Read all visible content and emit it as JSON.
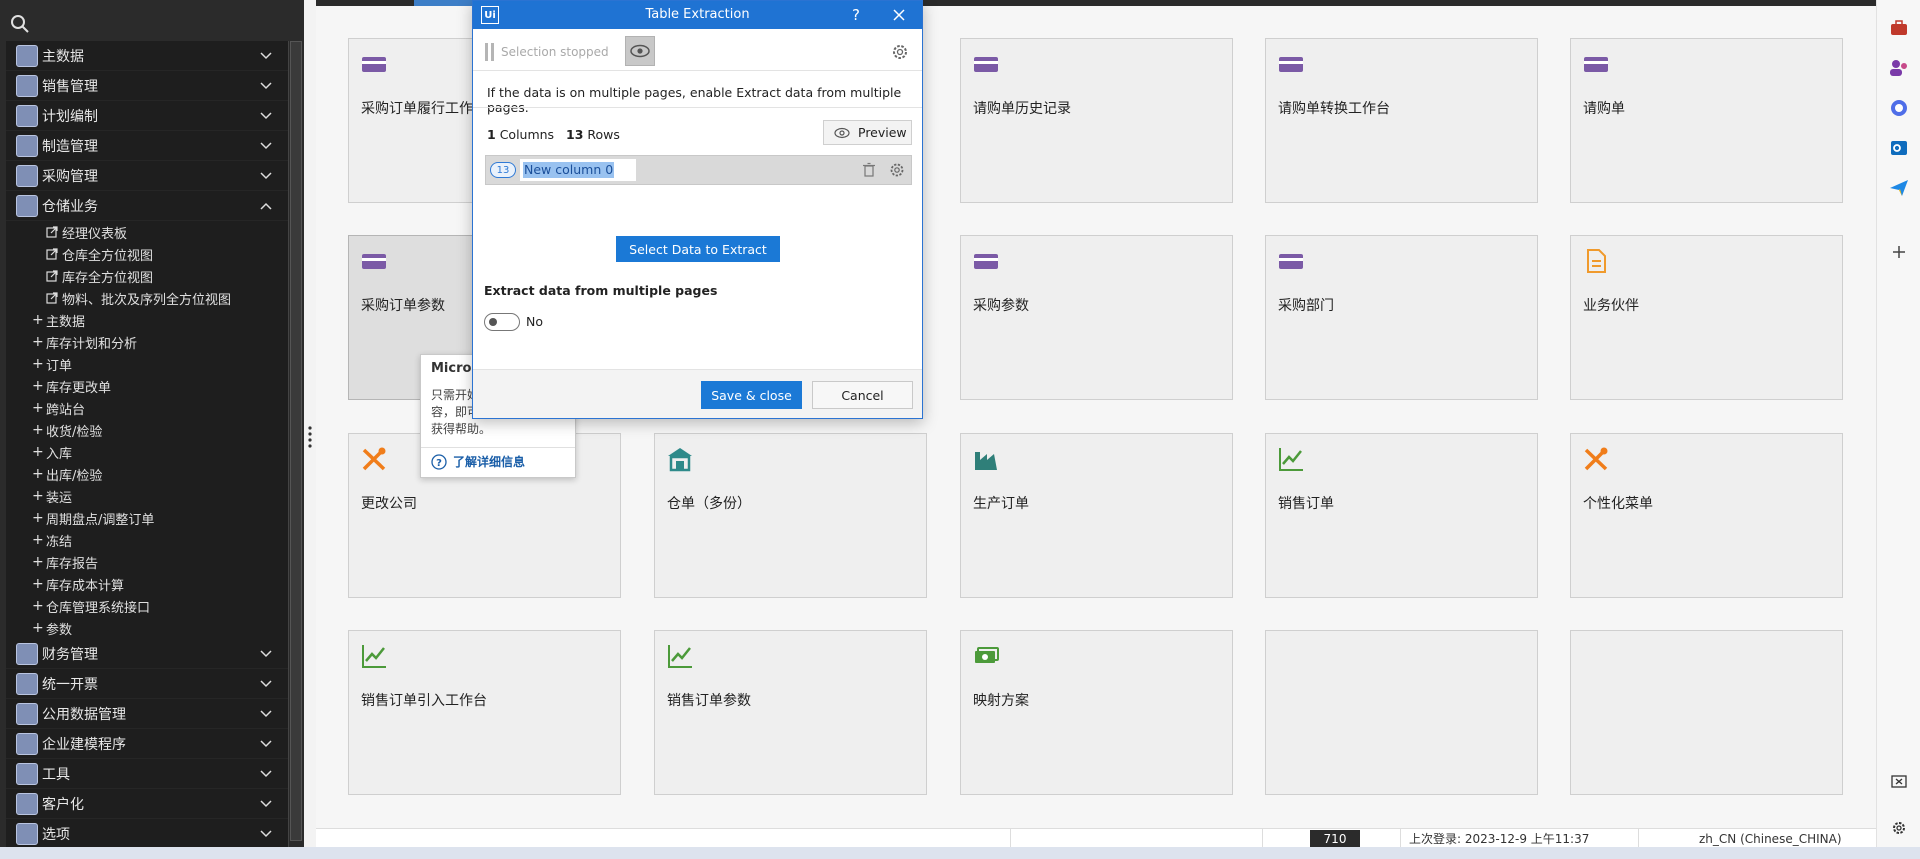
{
  "sidebar": {
    "modules_top": [
      {
        "label": "主数据"
      },
      {
        "label": "销售管理"
      },
      {
        "label": "计划编制"
      },
      {
        "label": "制造管理"
      },
      {
        "label": "采购管理"
      }
    ],
    "expanded_module": {
      "label": "仓储业务"
    },
    "links": [
      {
        "label": "经理仪表板"
      },
      {
        "label": "仓库全方位视图"
      },
      {
        "label": "库存全方位视图"
      },
      {
        "label": "物料、批次及序列全方位视图"
      }
    ],
    "groups": [
      {
        "label": "主数据"
      },
      {
        "label": "库存计划和分析"
      },
      {
        "label": "订单"
      },
      {
        "label": "库存更改单"
      },
      {
        "label": "跨站台"
      },
      {
        "label": "收货/检验"
      },
      {
        "label": "入库"
      },
      {
        "label": "出库/检验"
      },
      {
        "label": "装运"
      },
      {
        "label": "周期盘点/调整订单"
      },
      {
        "label": "冻结"
      },
      {
        "label": "库存报告"
      },
      {
        "label": "库存成本计算"
      },
      {
        "label": "仓库管理系统接口"
      },
      {
        "label": "参数"
      }
    ],
    "modules_bottom": [
      {
        "label": "财务管理"
      },
      {
        "label": "统一开票"
      },
      {
        "label": "公用数据管理"
      },
      {
        "label": "企业建模程序"
      },
      {
        "label": "工具"
      },
      {
        "label": "客户化"
      },
      {
        "label": "选项"
      }
    ]
  },
  "tiles": [
    {
      "label": "采购订单履行工作",
      "icon": "card-icon",
      "color": "#7b5aa6"
    },
    {
      "label": "请购单历史记录",
      "icon": "card-icon",
      "color": "#7b5aa6"
    },
    {
      "label": "请购单转换工作台",
      "icon": "card-icon",
      "color": "#7b5aa6"
    },
    {
      "label": "请购单",
      "icon": "card-icon",
      "color": "#7b5aa6"
    },
    {
      "label": "采购订单参数",
      "icon": "card-icon",
      "color": "#7b5aa6"
    },
    {
      "label": "采购参数",
      "icon": "card-icon",
      "color": "#7b5aa6"
    },
    {
      "label": "采购部门",
      "icon": "card-icon",
      "color": "#7b5aa6"
    },
    {
      "label": "业务伙伴",
      "icon": "document-icon",
      "color": "#f09a2c"
    },
    {
      "label": "更改公司",
      "icon": "tools-icon",
      "color": "#f07d1a"
    },
    {
      "label": "仓单（多份）",
      "icon": "warehouse-icon",
      "color": "#2e8a8a"
    },
    {
      "label": "生产订单",
      "icon": "factory-icon",
      "color": "#2f7f79"
    },
    {
      "label": "销售订单",
      "icon": "line-chart-icon",
      "color": "#4c9a3a"
    },
    {
      "label": "个性化菜单",
      "icon": "tools-icon",
      "color": "#f07d1a"
    },
    {
      "label": "销售订单引入工作台",
      "icon": "line-chart-icon",
      "color": "#4c9a3a"
    },
    {
      "label": "销售订单参数",
      "icon": "line-chart-icon",
      "color": "#4c9a3a"
    },
    {
      "label": "映射方案",
      "icon": "cash-icon",
      "color": "#4c9a3a"
    },
    {
      "label": "",
      "icon": "",
      "color": ""
    },
    {
      "label": "",
      "icon": "",
      "color": ""
    }
  ],
  "statusbar": {
    "counter": "710",
    "last_login": "上次登录: 2023-12-9 上午11:37",
    "locale": "zh_CN (Chinese_CHINA)"
  },
  "tooltip": {
    "title": "Micros",
    "body_lines": [
      "只需开始",
      "容，即可",
      "获得帮助。"
    ],
    "link": "了解详细信息"
  },
  "dialog": {
    "app_logo": "Ui",
    "title": "Table Extraction",
    "help": "?",
    "selection_status": "Selection stopped",
    "info": "If the data is on multiple pages, enable Extract data from multiple pages.",
    "columns_count": "1",
    "columns_label": "Columns",
    "rows_count": "13",
    "rows_label": "Rows",
    "preview_label": "Preview",
    "column_badge": "13",
    "column_name": "New column 0",
    "select_data_label": "Select Data to Extract",
    "multi_page_title": "Extract data from multiple pages",
    "multi_page_value": "No",
    "save_label": "Save & close",
    "cancel_label": "Cancel"
  },
  "colors": {
    "accent": "#1b79d6",
    "sidebar_bg": "#2b2b2b",
    "tile_bg": "#efefef"
  }
}
